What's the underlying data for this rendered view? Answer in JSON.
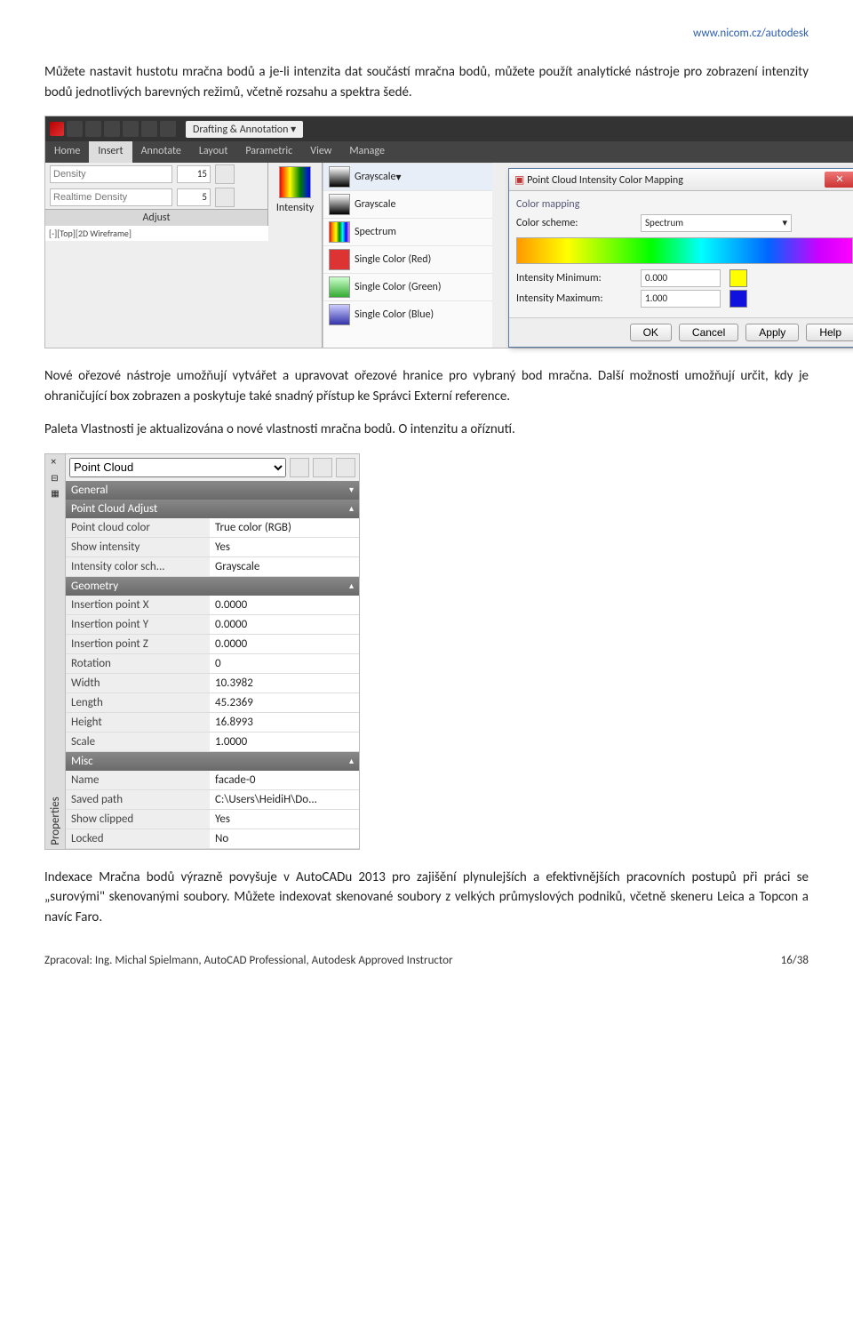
{
  "header_link": "www.nicom.cz/autodesk",
  "para1": "Můžete nastavit hustotu mračna bodů a je-li intenzita dat součástí mračna bodů, můžete použít analytické nástroje pro zobrazení intenzity bodů jednotlivých barevných režimů, včetně rozsahu a spektra šedé.",
  "ribbon": {
    "workspace": "Drafting & Annotation",
    "tabs": [
      "Home",
      "Insert",
      "Annotate",
      "Layout",
      "Parametric",
      "View",
      "Manage"
    ],
    "density_label": "Density",
    "density_val": "15",
    "realtime_label": "Realtime Density",
    "realtime_val": "5",
    "adjust": "Adjust",
    "viewport": "[-][Top][2D Wireframe]",
    "intensity": "Intensity",
    "grayscale_btn": "Grayscale",
    "opts": [
      "Grayscale",
      "Spectrum",
      "Single Color (Red)",
      "Single Color (Green)",
      "Single Color (Blue)"
    ]
  },
  "dialog": {
    "title": "Point Cloud Intensity Color Mapping",
    "section": "Color mapping",
    "scheme_label": "Color scheme:",
    "scheme_value": "Spectrum",
    "min_label": "Intensity Minimum:",
    "min_val": "0.000",
    "max_label": "Intensity Maximum:",
    "max_val": "1.000",
    "btns": [
      "OK",
      "Cancel",
      "Apply",
      "Help"
    ]
  },
  "para2": "Nové ořezové nástroje umožňují vytvářet a upravovat ořezové hranice pro vybraný bod mračna. Další možnosti umožňují určit, kdy je ohraničující box zobrazen a poskytuje také snadný přístup ke Správci Externí reference.",
  "para3": "Paleta Vlastnosti je aktualizována o nové vlastnosti mračna bodů. O intenzitu a oříznutí.",
  "props": {
    "side_label": "Properties",
    "object": "Point Cloud",
    "sections": {
      "general": "General",
      "adjust": "Point Cloud Adjust",
      "geometry": "Geometry",
      "misc": "Misc"
    },
    "adjust_rows": [
      [
        "Point cloud color",
        "True color (RGB)"
      ],
      [
        "Show intensity",
        "Yes"
      ],
      [
        "Intensity color sch...",
        "Grayscale"
      ]
    ],
    "geom_rows": [
      [
        "Insertion point X",
        "0.0000"
      ],
      [
        "Insertion point Y",
        "0.0000"
      ],
      [
        "Insertion point Z",
        "0.0000"
      ],
      [
        "Rotation",
        "0"
      ],
      [
        "Width",
        "10.3982"
      ],
      [
        "Length",
        "45.2369"
      ],
      [
        "Height",
        "16.8993"
      ],
      [
        "Scale",
        "1.0000"
      ]
    ],
    "misc_rows": [
      [
        "Name",
        "facade-0"
      ],
      [
        "Saved path",
        "C:\\Users\\HeidiH\\Do..."
      ],
      [
        "Show clipped",
        "Yes"
      ],
      [
        "Locked",
        "No"
      ]
    ]
  },
  "para4": "Indexace Mračna bodů výrazně povyšuje v AutoCADu 2013 pro zajišění plynulejších a efektivnějších pracovních postupů při práci se „surovými\" skenovanými soubory. Můžete indexovat skenované soubory z velkých průmyslových podniků, včetně skeneru Leica a Topcon a navíc Faro.",
  "footer_left": "Zpracoval: Ing. Michal Spielmann, AutoCAD Professional, Autodesk Approved Instructor",
  "footer_right": "16/38"
}
